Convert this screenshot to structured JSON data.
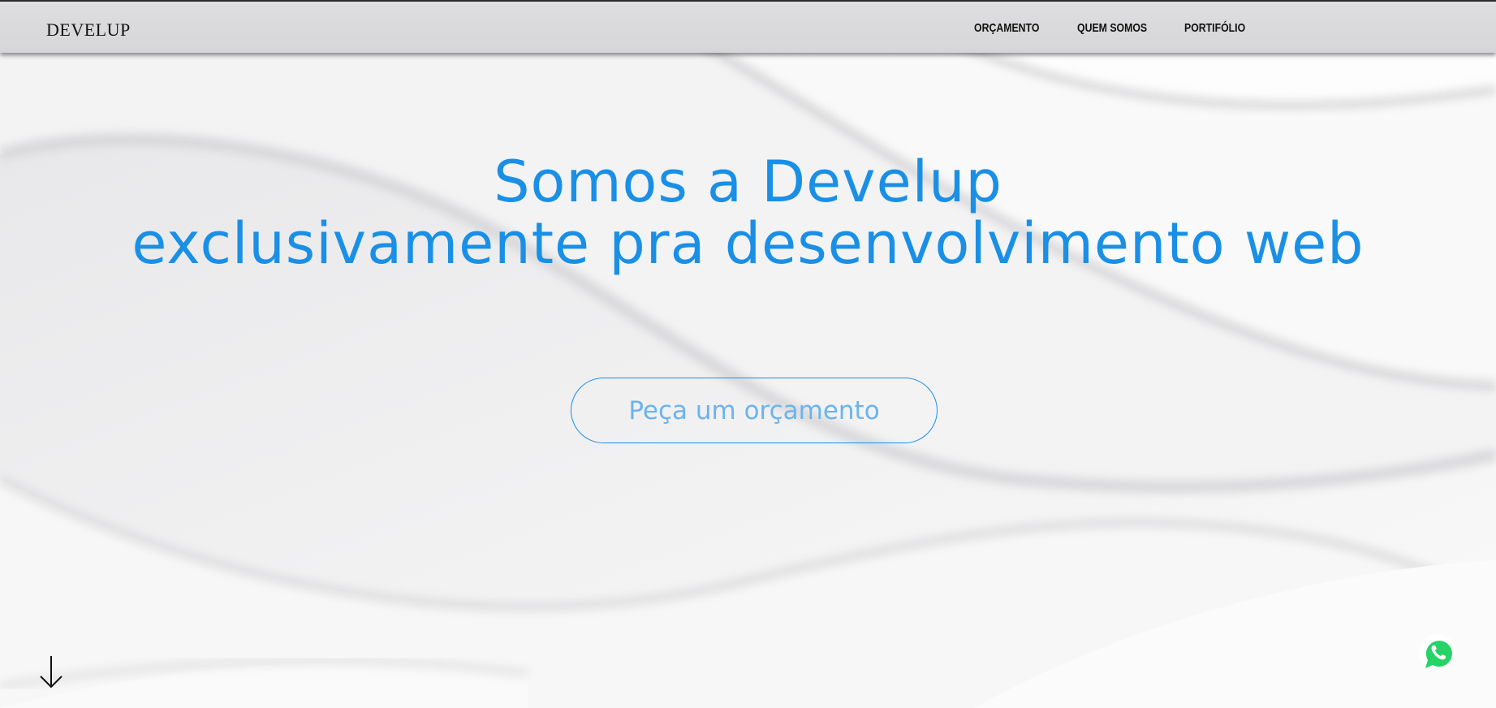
{
  "navbar": {
    "logo": "DEVELUP",
    "links": [
      {
        "label": "ORÇAMENTO"
      },
      {
        "label": "QUEM SOMOS"
      },
      {
        "label": "PORTIFÓLIO"
      }
    ]
  },
  "hero": {
    "title_line1": "Somos a Develup",
    "title_line2": "exclusivamente pra desenvolvimento web",
    "cta_label": "Peça um orçamento"
  },
  "icons": {
    "scroll_down": "arrow-down-icon",
    "whatsapp": "whatsapp-icon"
  },
  "colors": {
    "accent": "#1a8fe6",
    "cta_text": "#6cb3ee",
    "navbar_bg": "#dadadc",
    "whatsapp_green": "#25d366"
  }
}
